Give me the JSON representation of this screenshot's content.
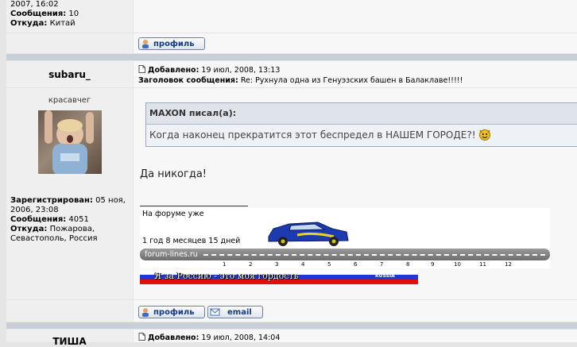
{
  "prev_post": {
    "date_line": "2007, 16:02",
    "messages_label": "Сообщения:",
    "messages_value": "10",
    "from_label": "Откуда:",
    "from_value": "Китай",
    "profile_button": "профиль"
  },
  "post": {
    "username": "subaru_",
    "rank": "красавчег",
    "posted_label": "Добавлено:",
    "posted_value": "19 июл, 2008, 13:13",
    "subject_label": "Заголовок сообщения:",
    "subject_value": "Re: Рухнула одна из Генуэзских башен в Балаклаве!!!!!",
    "registered_label": "Зарегистрирован:",
    "registered_value_1": "05 ноя,",
    "registered_value_2": "2006, 23:08",
    "messages_label": "Сообщения:",
    "messages_value": "4051",
    "from_label": "Откуда:",
    "from_value_1": "Пожарова,",
    "from_value_2": "Севастополь, Россия",
    "quote_author": "MAXON писал(а):",
    "quote_text": "Когда наконец прекратится этот беспредел в НАШЕМ ГОРОДЕ?!",
    "reply_text": "Да никогда!",
    "sig_line1": "На форуме уже",
    "sig_line2": "1 год 8 месяцев 15 дней",
    "sig_site": "forum-lines.ru",
    "sig_ticks": [
      "1",
      "2",
      "3",
      "4",
      "5",
      "6",
      "7",
      "8",
      "9",
      "10",
      "11",
      "12"
    ],
    "russia_text": "Я за Россию - это моя гордость",
    "russia_small": "RUSSIA",
    "profile_button": "профиль",
    "email_button": "email"
  },
  "next_post": {
    "username": "ТИША",
    "posted_label": "Добавлено:",
    "posted_value": "19 июл, 2008, 14:04"
  },
  "colors": {
    "link_blue": "#123a86",
    "separator": "#c9cfd8"
  }
}
